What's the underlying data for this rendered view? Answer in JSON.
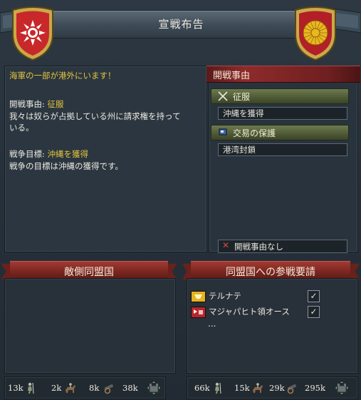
{
  "window": {
    "title": "宣戦布告"
  },
  "left_panel": {
    "alert": "海軍の一部が港外にいます！",
    "cb_label": "開戦事由:",
    "cb_value": "征服",
    "cb_desc_line1": "我々は奴らが占拠している州に請求権を持って",
    "cb_desc_line2": "いる。",
    "goal_label": "戦争目標:",
    "goal_value": "沖縄を獲得",
    "goal_desc": "戦争の目標は沖縄の獲得です。"
  },
  "right_panel": {
    "header": "開戦事由",
    "casus_belli": [
      {
        "title": "征服",
        "icon": "crossed-swords-icon",
        "option": "沖縄を獲得"
      },
      {
        "title": "交易の保護",
        "icon": "trade-flag-icon",
        "option": "港湾封鎖"
      }
    ],
    "no_cb_label": "開戦事由なし",
    "no_cb_icon": "x-mark-icon"
  },
  "enemy_allies": {
    "header": "敵側同盟国",
    "stats": {
      "infantry": "13k",
      "cavalry": "2k",
      "artillery": "8k",
      "navy": "38k"
    }
  },
  "call_allies": {
    "header": "同盟国への参戦要請",
    "allies": [
      {
        "name": "テルナテ",
        "checked": true,
        "flag_color": "#e3b21e"
      },
      {
        "name": "マジャパヒト領オース",
        "checked": true,
        "flag_color": "#b9242a"
      }
    ],
    "more": "...",
    "stats": {
      "infantry": "66k",
      "cavalry": "15k",
      "artillery": "29k",
      "navy": "295k"
    }
  },
  "colors": {
    "accent_yellow": "#e6c63d",
    "ribbon_red": "#8e2b2b",
    "panel": "#2b3640"
  }
}
